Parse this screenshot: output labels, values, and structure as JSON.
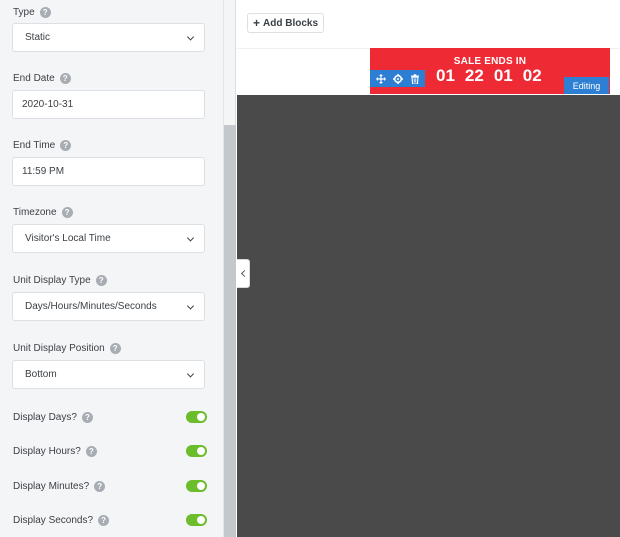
{
  "panel": {
    "type": {
      "label": "Type",
      "value": "Static"
    },
    "end_date": {
      "label": "End Date",
      "value": "2020-10-31"
    },
    "end_time": {
      "label": "End Time",
      "value": "11:59 PM"
    },
    "timezone": {
      "label": "Timezone",
      "value": "Visitor's Local Time"
    },
    "unit_display_type": {
      "label": "Unit Display Type",
      "value": "Days/Hours/Minutes/Seconds"
    },
    "unit_display_position": {
      "label": "Unit Display Position",
      "value": "Bottom"
    },
    "toggles": [
      {
        "label": "Display Days?",
        "on": true
      },
      {
        "label": "Display Hours?",
        "on": true
      },
      {
        "label": "Display Minutes?",
        "on": true
      },
      {
        "label": "Display Seconds?",
        "on": true
      }
    ],
    "help_glyph": "?",
    "toggle_color": "#6bbd2c"
  },
  "canvas": {
    "add_blocks_label": "Add Blocks",
    "add_blocks_icon": "plus-icon",
    "banner": {
      "title": "SALE ENDS IN",
      "days": "01",
      "hours": "22",
      "minutes": "01",
      "seconds": "02",
      "color": "#ee2a35"
    },
    "block_tools": [
      "move-icon",
      "gear-icon",
      "trash-icon"
    ],
    "editing_label": "Editing",
    "accent": "#2d7fd3"
  }
}
